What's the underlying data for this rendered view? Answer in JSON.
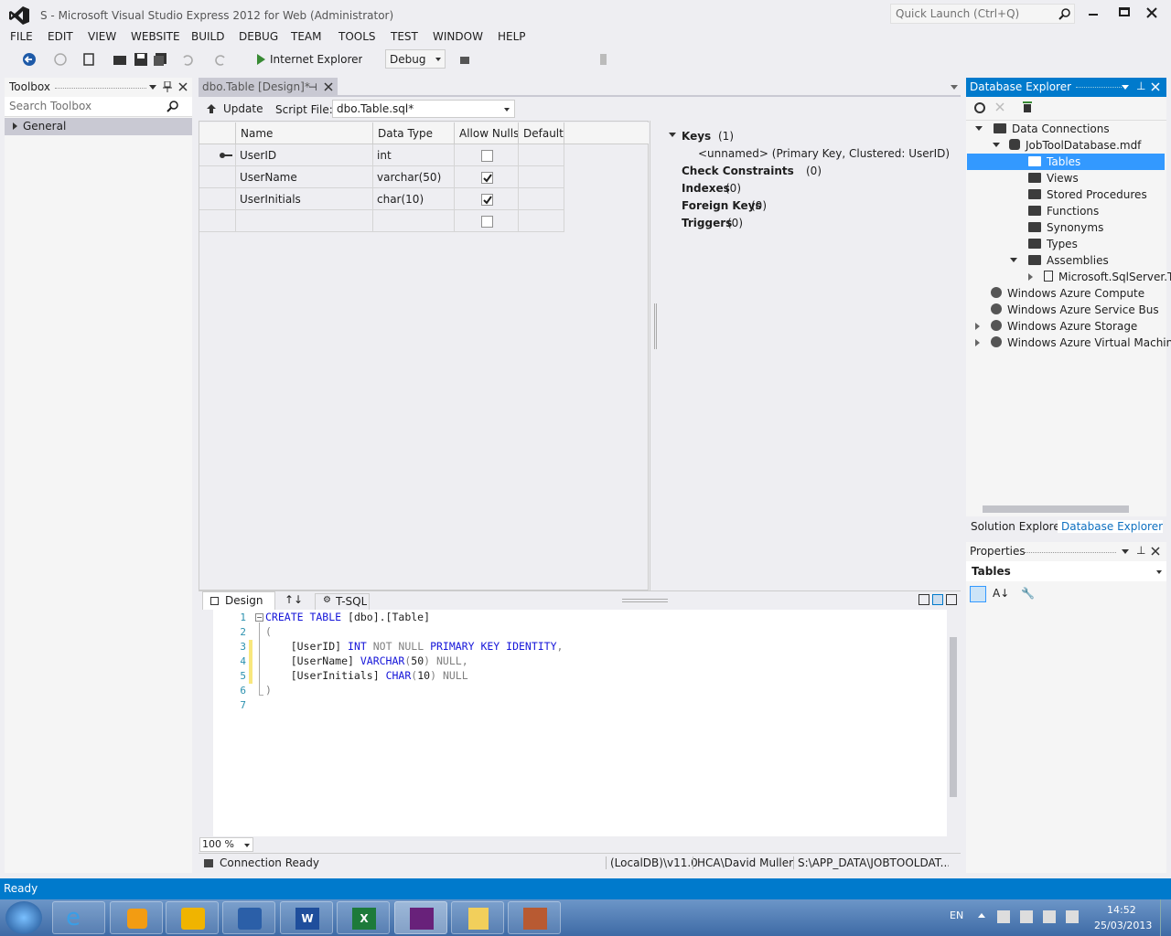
{
  "window": {
    "title": "S - Microsoft Visual Studio Express 2012 for Web (Administrator)",
    "quick_launch_placeholder": "Quick Launch (Ctrl+Q)"
  },
  "menu": [
    "FILE",
    "EDIT",
    "VIEW",
    "WEBSITE",
    "BUILD",
    "DEBUG",
    "TEAM",
    "TOOLS",
    "TEST",
    "WINDOW",
    "HELP"
  ],
  "toolbar": {
    "run_label": "Internet Explorer",
    "config": "Debug"
  },
  "toolbox": {
    "title": "Toolbox",
    "search_placeholder": "Search Toolbox",
    "general": "General"
  },
  "editor": {
    "tab_label": "dbo.Table [Design]*",
    "update_label": "Update",
    "script_file_label": "Script File:",
    "script_file_value": "dbo.Table.sql*"
  },
  "grid": {
    "headers": [
      "Name",
      "Data Type",
      "Allow Nulls",
      "Default"
    ],
    "rows": [
      {
        "name": "UserID",
        "type": "int",
        "allow_nulls": false,
        "pk": true
      },
      {
        "name": "UserName",
        "type": "varchar(50)",
        "allow_nulls": true,
        "pk": false
      },
      {
        "name": "UserInitials",
        "type": "char(10)",
        "allow_nulls": true,
        "pk": false
      },
      {
        "name": "",
        "type": "",
        "allow_nulls": false,
        "pk": false
      }
    ]
  },
  "keys_panel": {
    "keys": "Keys",
    "keys_count": "(1)",
    "unnamed_key": "<unnamed>  (Primary Key, Clustered: UserID)",
    "check_constraints": "Check Constraints",
    "check_count": "(0)",
    "indexes": "Indexes",
    "indexes_count": "(0)",
    "foreign_keys": "Foreign Keys",
    "foreign_count": "(0)",
    "triggers": "Triggers",
    "triggers_count": "(0)"
  },
  "bottom_tabs": {
    "design": "Design",
    "tsql": "T-SQL"
  },
  "sql_lines": [
    "1",
    "2",
    "3",
    "4",
    "5",
    "6",
    "7"
  ],
  "zoom": "100 %",
  "editor_status": {
    "connection": "Connection Ready",
    "server": "(LocalDB)\\v11.0",
    "user": "HCA\\David Muller",
    "path": "S:\\APP_DATA\\JOBTOOLDAT..."
  },
  "db_explorer": {
    "title": "Database Explorer",
    "data_connections": "Data Connections",
    "database": "JobToolDatabase.mdf",
    "items": [
      "Tables",
      "Views",
      "Stored Procedures",
      "Functions",
      "Synonyms",
      "Types",
      "Assemblies"
    ],
    "assembly": "Microsoft.SqlServer.T",
    "azure": [
      "Windows Azure Compute",
      "Windows Azure Service Bus",
      "Windows Azure Storage",
      "Windows Azure Virtual Machine"
    ],
    "tab_solution": "Solution Explorer",
    "tab_database": "Database Explorer"
  },
  "properties": {
    "title": "Properties",
    "selected": "Tables"
  },
  "statusbar": {
    "text": "Ready"
  },
  "taskbar": {
    "lang": "EN",
    "time": "14:52",
    "date": "25/03/2013"
  },
  "colors": {
    "accent": "#007acc",
    "selection": "#3399ff",
    "keyword": "#1515d9"
  }
}
